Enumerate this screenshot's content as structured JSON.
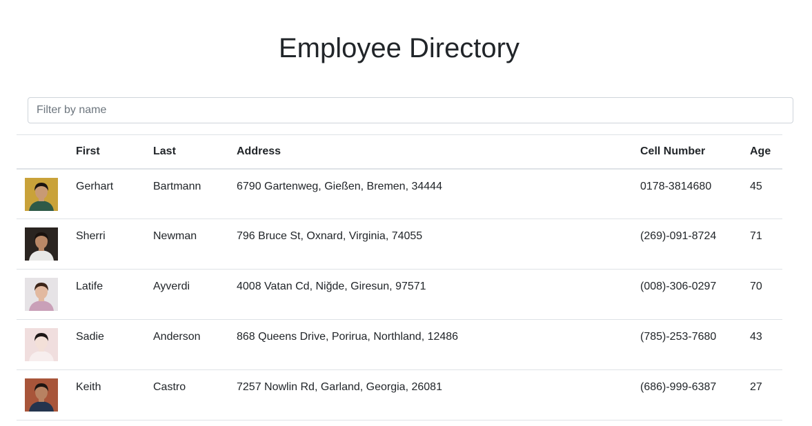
{
  "page": {
    "title": "Employee Directory"
  },
  "filter": {
    "placeholder": "Filter by name",
    "value": ""
  },
  "table": {
    "headers": {
      "image": "",
      "first": "First",
      "last": "Last",
      "address": "Address",
      "cell": "Cell Number",
      "age": "Age"
    },
    "rows": [
      {
        "first": "Gerhart",
        "last": "Bartmann",
        "address": "6790 Gartenweg, Gießen, Bremen, 34444",
        "cell": "0178-3814680",
        "age": "45",
        "avatar": {
          "bg": "#c9a23a",
          "skin": "#c89a74",
          "hair": "#1b1410",
          "shirt": "#2f5a48"
        }
      },
      {
        "first": "Sherri",
        "last": "Newman",
        "address": "796 Bruce St, Oxnard, Virginia, 74055",
        "cell": "(269)-091-8724",
        "age": "71",
        "avatar": {
          "bg": "#2a2420",
          "skin": "#b98867",
          "hair": "#1a120e",
          "shirt": "#e8e8e6"
        }
      },
      {
        "first": "Latife",
        "last": "Ayverdi",
        "address": "4008 Vatan Cd, Niğde, Giresun, 97571",
        "cell": "(008)-306-0297",
        "age": "70",
        "avatar": {
          "bg": "#e6e3e6",
          "skin": "#e2b9a0",
          "hair": "#3b2418",
          "shirt": "#c9a0b8"
        }
      },
      {
        "first": "Sadie",
        "last": "Anderson",
        "address": "868 Queens Drive, Porirua, Northland, 12486",
        "cell": "(785)-253-7680",
        "age": "43",
        "avatar": {
          "bg": "#f0dede",
          "skin": "#f3e0d8",
          "hair": "#1c1616",
          "shirt": "#f7eeee"
        }
      },
      {
        "first": "Keith",
        "last": "Castro",
        "address": "7257 Nowlin Rd, Garland, Georgia, 26081",
        "cell": "(686)-999-6387",
        "age": "27",
        "avatar": {
          "bg": "#a8553a",
          "skin": "#b88262",
          "hair": "#1e1512",
          "shirt": "#24344e"
        }
      }
    ]
  }
}
